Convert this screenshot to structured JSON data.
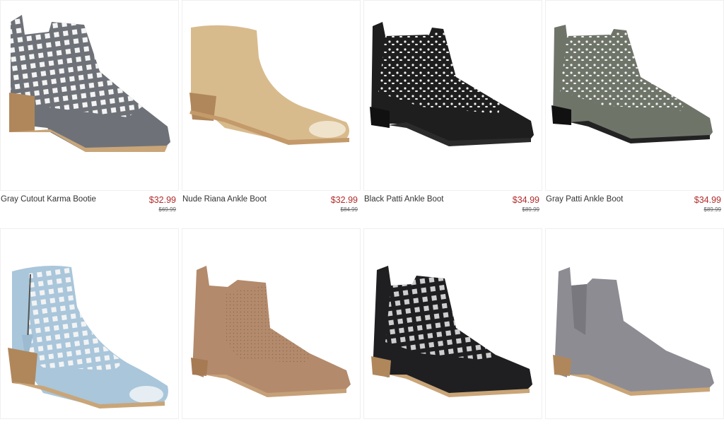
{
  "products": [
    {
      "name": "Gray Cutout Karma Bootie",
      "price": "$32.99",
      "original_price": "$69.99",
      "image": "gray-cutout-bootie-image",
      "color": "#6e7278"
    },
    {
      "name": "Nude Riana Ankle Boot",
      "price": "$32.99",
      "original_price": "$84.99",
      "image": "nude-peep-toe-boot-image",
      "color": "#d8bb8d"
    },
    {
      "name": "Black Patti Ankle Boot",
      "price": "$34.99",
      "original_price": "$89.99",
      "image": "black-laser-cut-boot-image",
      "color": "#1e1e1e"
    },
    {
      "name": "Gray Patti Ankle Boot",
      "price": "$34.99",
      "original_price": "$89.99",
      "image": "gray-laser-cut-boot-image",
      "color": "#6f7469"
    },
    {
      "name": "",
      "price": "",
      "original_price": "",
      "image": "light-blue-peep-toe-cutout-bootie-image",
      "color": "#a9c6db"
    },
    {
      "name": "",
      "price": "",
      "original_price": "",
      "image": "taupe-perforated-ankle-boot-image",
      "color": "#b38a6c"
    },
    {
      "name": "",
      "price": "",
      "original_price": "",
      "image": "black-cutout-bootie-image",
      "color": "#1f1f22"
    },
    {
      "name": "",
      "price": "",
      "original_price": "",
      "image": "gray-suede-ankle-boot-image",
      "color": "#8e8c93"
    }
  ],
  "colors": {
    "price": "#b32b2b",
    "heel_wood": "#b0875b"
  }
}
